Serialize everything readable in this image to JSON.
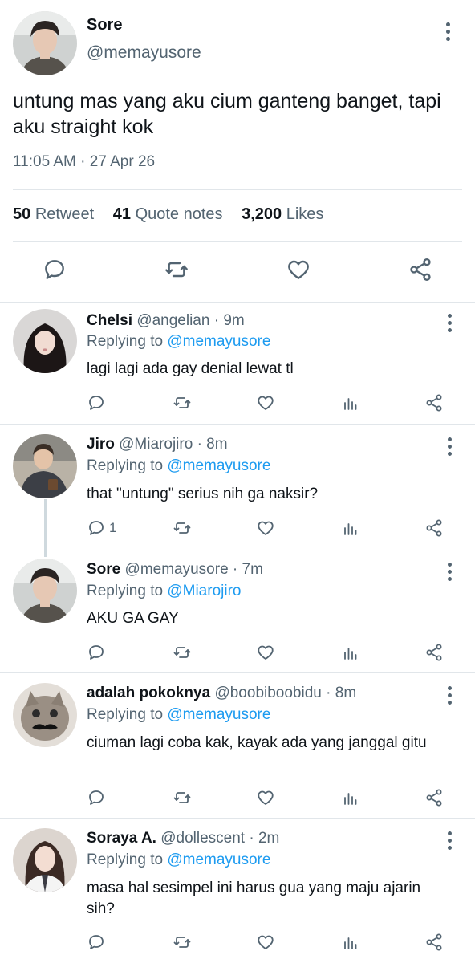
{
  "main": {
    "name": "Sore",
    "handle": "@memayusore",
    "text": "untung mas yang aku cium ganteng banget, tapi aku straight kok",
    "time": "11:05 AM · 27 Apr 26",
    "stats": {
      "retweets_count": "50",
      "retweets_label": "Retweet",
      "quotes_count": "41",
      "quotes_label": "Quote notes",
      "likes_count": "3,200",
      "likes_label": "Likes"
    }
  },
  "replies": [
    {
      "name": "Chelsi",
      "handle": "@angelian",
      "time": "· 9m",
      "replying_label": "Replying to",
      "replying_to": "@memayusore",
      "text": "lagi lagi ada gay denial lewat tl",
      "reply_count": ""
    },
    {
      "name": "Jiro",
      "handle": "@Miarojiro",
      "time": "· 8m",
      "replying_label": "Replying to",
      "replying_to": "@memayusore",
      "text": "that \"untung\" serius nih ga naksir?",
      "reply_count": "1"
    },
    {
      "name": "Sore",
      "handle": "@memayusore",
      "time": "· 7m",
      "replying_label": "Replying to",
      "replying_to": "@Miarojiro",
      "text": "AKU GA GAY",
      "reply_count": ""
    },
    {
      "name": "adalah pokoknya",
      "handle": "@boobiboobidu",
      "time": "· 8m",
      "replying_label": "Replying to",
      "replying_to": "@memayusore",
      "text": "ciuman lagi coba kak, kayak ada yang janggal gitu",
      "reply_count": ""
    },
    {
      "name": "Soraya A.",
      "handle": "@dollescent",
      "time": "· 2m",
      "replying_label": "Replying to",
      "replying_to": "@memayusore",
      "text": "masa hal sesimpel ini harus gua yang maju ajarin sih?",
      "reply_count": ""
    }
  ],
  "icons": [
    "more-vertical-icon",
    "reply-icon",
    "retweet-icon",
    "like-icon",
    "share-icon",
    "views-icon"
  ],
  "colors": {
    "link": "#1d9bf0",
    "secondary": "#536471",
    "divider": "#e1e6ea"
  }
}
